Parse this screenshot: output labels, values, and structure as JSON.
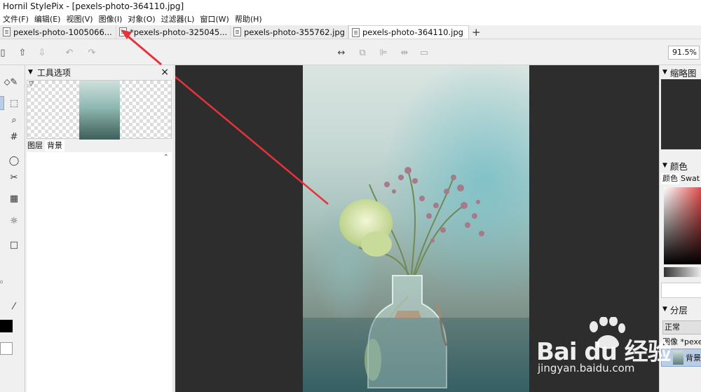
{
  "window": {
    "title": "Hornil StylePix - [pexels-photo-364110.jpg]"
  },
  "menu": [
    "文件(F)",
    "编辑(E)",
    "视图(V)",
    "图像(I)",
    "对象(O)",
    "过滤器(L)",
    "窗口(W)",
    "帮助(H)"
  ],
  "tabs": [
    {
      "label": "pexels-photo-1005066...",
      "active": false
    },
    {
      "label": "*pexels-photo-325045...",
      "active": false
    },
    {
      "label": "pexels-photo-355762.jpg",
      "active": false
    },
    {
      "label": "pexels-photo-364110.jpg",
      "active": true
    }
  ],
  "tab_close_glyph": "×",
  "new_tab_glyph": "+",
  "zoom": {
    "value": "91.5%"
  },
  "tool_panel": {
    "title": "工具选项",
    "close": "×",
    "tabs": [
      "图层",
      "背景"
    ]
  },
  "right_panel": {
    "navigator": "缩略图",
    "color": "颜色",
    "color_tabs": [
      "颜色",
      "Swat"
    ],
    "layers": "分层",
    "blend_mode": "正常",
    "layer_image_label": "图像 *pexel",
    "layer_name": "背景"
  },
  "watermark": {
    "main": "Bai du 经验",
    "url": "jingyan.baidu.com"
  },
  "colors": {
    "canvas_bg": "#2d2d2d",
    "selection": "#b9cde6",
    "annotation_arrow": "#e8323a"
  }
}
